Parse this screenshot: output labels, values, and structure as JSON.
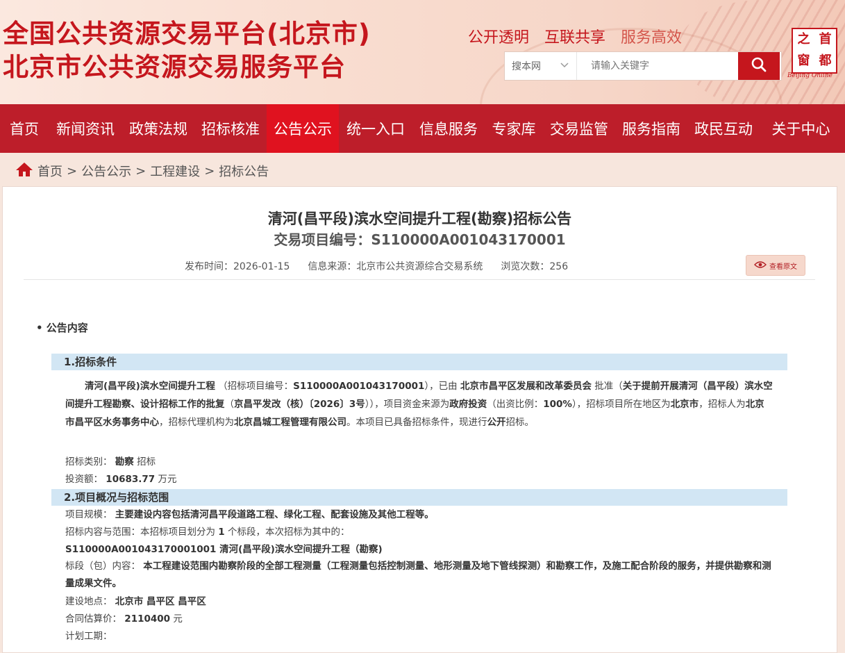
{
  "header": {
    "title_line1": "全国公共资源交易平台(北京市)",
    "title_line2": "北京市公共资源交易服务平台",
    "slogans": [
      "公开透明",
      "互联共享",
      "服务高效"
    ],
    "search_scope": "搜本网",
    "search_placeholder": "请输入关键字",
    "seal_chars": [
      "之",
      "首",
      "窗",
      "都"
    ],
    "seal_sub": "Beijing Online"
  },
  "nav": {
    "items": [
      "首页",
      "新闻资讯",
      "政策法规",
      "招标核准",
      "公告公示",
      "统一入口",
      "信息服务",
      "专家库",
      "交易监管",
      "服务指南",
      "政民互动",
      "关于中心"
    ],
    "active_index": 4
  },
  "breadcrumb": {
    "items": [
      "首页",
      "公告公示",
      "工程建设",
      "招标公告"
    ],
    "separator": ">"
  },
  "doc": {
    "title": "清河(昌平段)滨水空间提升工程(勘察)招标公告",
    "code_label": "交易项目编号：",
    "code": "S110000A001043170001",
    "publish_time_label": "发布时间：",
    "publish_time": "2026-01-15",
    "source_label": "信息来源：",
    "source": "北京市公共资源综合交易系统",
    "views_label": "浏览次数：",
    "views": "256",
    "view_original": "查看原文",
    "section_heading": "• 公告内容",
    "section1_title": "1.招标条件",
    "section2_title": "2.项目概况与招标范围",
    "intro": {
      "project_name": "清河(昌平段)滨水空间提升工程",
      "t1": "（招标项目编号：",
      "project_code": "S110000A001043170001",
      "t2": "），已由",
      "approver": "北京市昌平区发展和改革委员会",
      "t3": "批准（",
      "approval_doc": "关于提前开展清河（昌平段）滨水空间提升工程勘察、设计招标工作的批复",
      "t4": "（",
      "approval_no": "京昌平发改（核）〔2026〕3号",
      "t5": "）），项目资金来源为",
      "fund_source": "政府投资",
      "t6": "（出资比例：",
      "fund_ratio": "100%",
      "t7": "），招标项目所在地区为",
      "region": "北京市",
      "t8": "，招标人为",
      "tenderer": "北京市昌平区水务事务中心",
      "t9": "，招标代理机构为",
      "agency": "北京昌城工程管理有限公司",
      "t10": "。本项目已具备招标条件，现进行",
      "method": "公开",
      "t11": "招标。"
    },
    "tender_type_label": "招标类别：",
    "tender_type": "勘察",
    "tender_type_suffix": "招标",
    "investment_label": "投资额：",
    "investment": "10683.77",
    "investment_unit": "万元",
    "scale_label": "项目规模：",
    "scale": "主要建设内容包括清河昌平段道路工程、绿化工程、配套设施及其他工程等。",
    "scope_label": "招标内容与范围：本招标项目划分为",
    "scope_count": "1",
    "scope_suffix": "个标段，本次招标为其中的：",
    "lot_name": "S110000A001043170001001 清河(昌平段)滨水空间提升工程（勘察)",
    "lot_content_label": "标段（包）内容：",
    "lot_content": "本工程建设范围内勘察阶段的全部工程测量（工程测量包括控制测量、地形测量及地下管线探测）和勘察工作，及施工配合阶段的服务，并提供勘察和测量成果文件。",
    "location_label": "建设地点：",
    "location": "北京市 昌平区 昌平区",
    "price_label": "合同估算价：",
    "price": "2110400",
    "price_unit": "元",
    "period_label": "计划工期："
  },
  "colors": {
    "brand_red": "#c5161d",
    "nav_bg": "#bd1e2a",
    "nav_active": "#e0121f",
    "section_bar": "#d2e6f4"
  }
}
